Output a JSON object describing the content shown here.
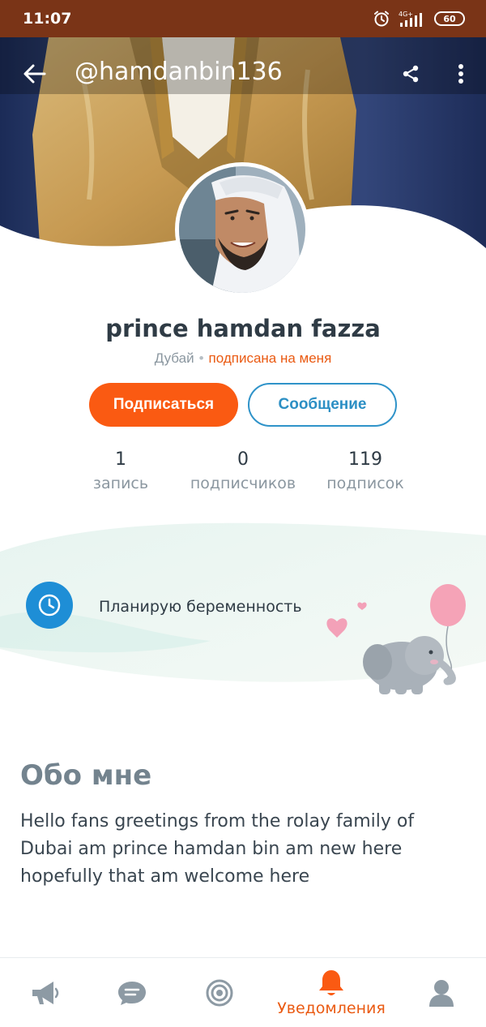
{
  "status_bar": {
    "time": "11:07",
    "network": "4G+",
    "battery": "60"
  },
  "header": {
    "handle": "@hamdanbin136"
  },
  "profile": {
    "name": "prince hamdan fazza",
    "city": "Дубай",
    "follows_me": "подписана на меня",
    "subscribe_label": "Подписаться",
    "message_label": "Сообщение"
  },
  "stats": [
    {
      "value": "1",
      "label": "запись"
    },
    {
      "value": "0",
      "label": "подписчиков"
    },
    {
      "value": "119",
      "label": "подписок"
    }
  ],
  "status_card": {
    "text": "Планирую беременность"
  },
  "about": {
    "title": "Обо мне",
    "text": "Hello fans greetings from the rolay family of Dubai am prince hamdan bin am new here hopefully that am welcome here"
  },
  "bottom_nav": {
    "items": [
      {
        "icon": "megaphone-icon",
        "label": ""
      },
      {
        "icon": "chat-bubble-icon",
        "label": ""
      },
      {
        "icon": "target-icon",
        "label": ""
      },
      {
        "icon": "bell-icon",
        "label": "Уведомления",
        "active": true
      },
      {
        "icon": "person-icon",
        "label": ""
      }
    ]
  },
  "colors": {
    "accent": "#fa5a12",
    "link_blue": "#2f93c9",
    "status_bar": "#7a3417",
    "clock_badge": "#1e8ed6"
  }
}
